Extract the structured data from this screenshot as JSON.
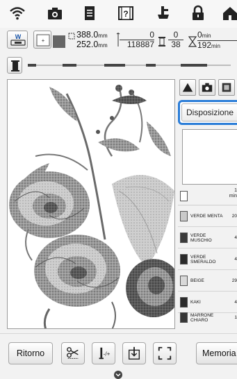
{
  "topbar": {
    "icons": [
      "wifi-icon",
      "camera-icon",
      "document-icon",
      "help-icon",
      "presser-foot-icon",
      "lock-icon",
      "home-icon"
    ]
  },
  "info": {
    "width_value": "388.0",
    "height_value": "252.0",
    "unit": "mm",
    "stitch_current": "0",
    "stitch_total": "118887",
    "color_current": "0",
    "color_total": "38",
    "time_current": "0",
    "time_total": "192",
    "time_unit": "min"
  },
  "panel": {
    "disposizione_label": "Disposizione",
    "total_time_value": "1",
    "total_time_unit": "min"
  },
  "thread_colors": [
    {
      "name": "VERDE MENTA",
      "minutes": "20",
      "color": "#c9c9c9"
    },
    {
      "name": "VERDE\nMUSCHIO",
      "minutes": "4",
      "color": "#3a3a3a"
    },
    {
      "name": "VERDE\nSMERALDO",
      "minutes": "4",
      "color": "#2a2a2a"
    },
    {
      "name": "BEIGE",
      "minutes": "29",
      "color": "#d9d9d9"
    },
    {
      "name": "KAKI",
      "minutes": "4",
      "color": "#2b2b2b"
    },
    {
      "name": "MARRONE\nCHIARO",
      "minutes": "1",
      "color": "#363636"
    }
  ],
  "bottom": {
    "back_label": "Ritorno",
    "memory_label": "Memoria"
  },
  "colors": {
    "accent": "#2a7dd8"
  }
}
